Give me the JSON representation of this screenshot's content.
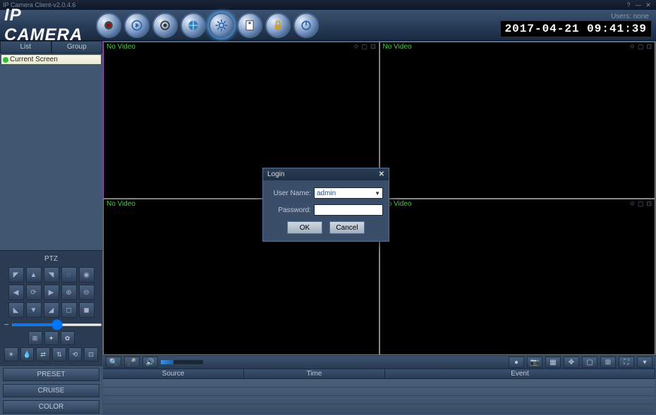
{
  "titlebar": {
    "title": "IP Camera Client-v2.0.4.6"
  },
  "header": {
    "logo": "IP CAMERA",
    "users_label": "Users: none",
    "datetime": "2017-04-21 09:41:39"
  },
  "sidebar": {
    "tabs": {
      "list": "List",
      "group": "Group"
    },
    "items": [
      {
        "label": "Current Screen"
      }
    ]
  },
  "ptz": {
    "title": "PTZ",
    "panels": {
      "preset": "PRESET",
      "cruise": "CRUISE",
      "color": "COLOR"
    }
  },
  "video": {
    "no_video": "No Video"
  },
  "log": {
    "cols": {
      "source": "Source",
      "time": "Time",
      "event": "Event"
    }
  },
  "login": {
    "title": "Login",
    "user_label": "User Name:",
    "user_value": "admin",
    "pass_label": "Password:",
    "ok": "OK",
    "cancel": "Cancel"
  }
}
